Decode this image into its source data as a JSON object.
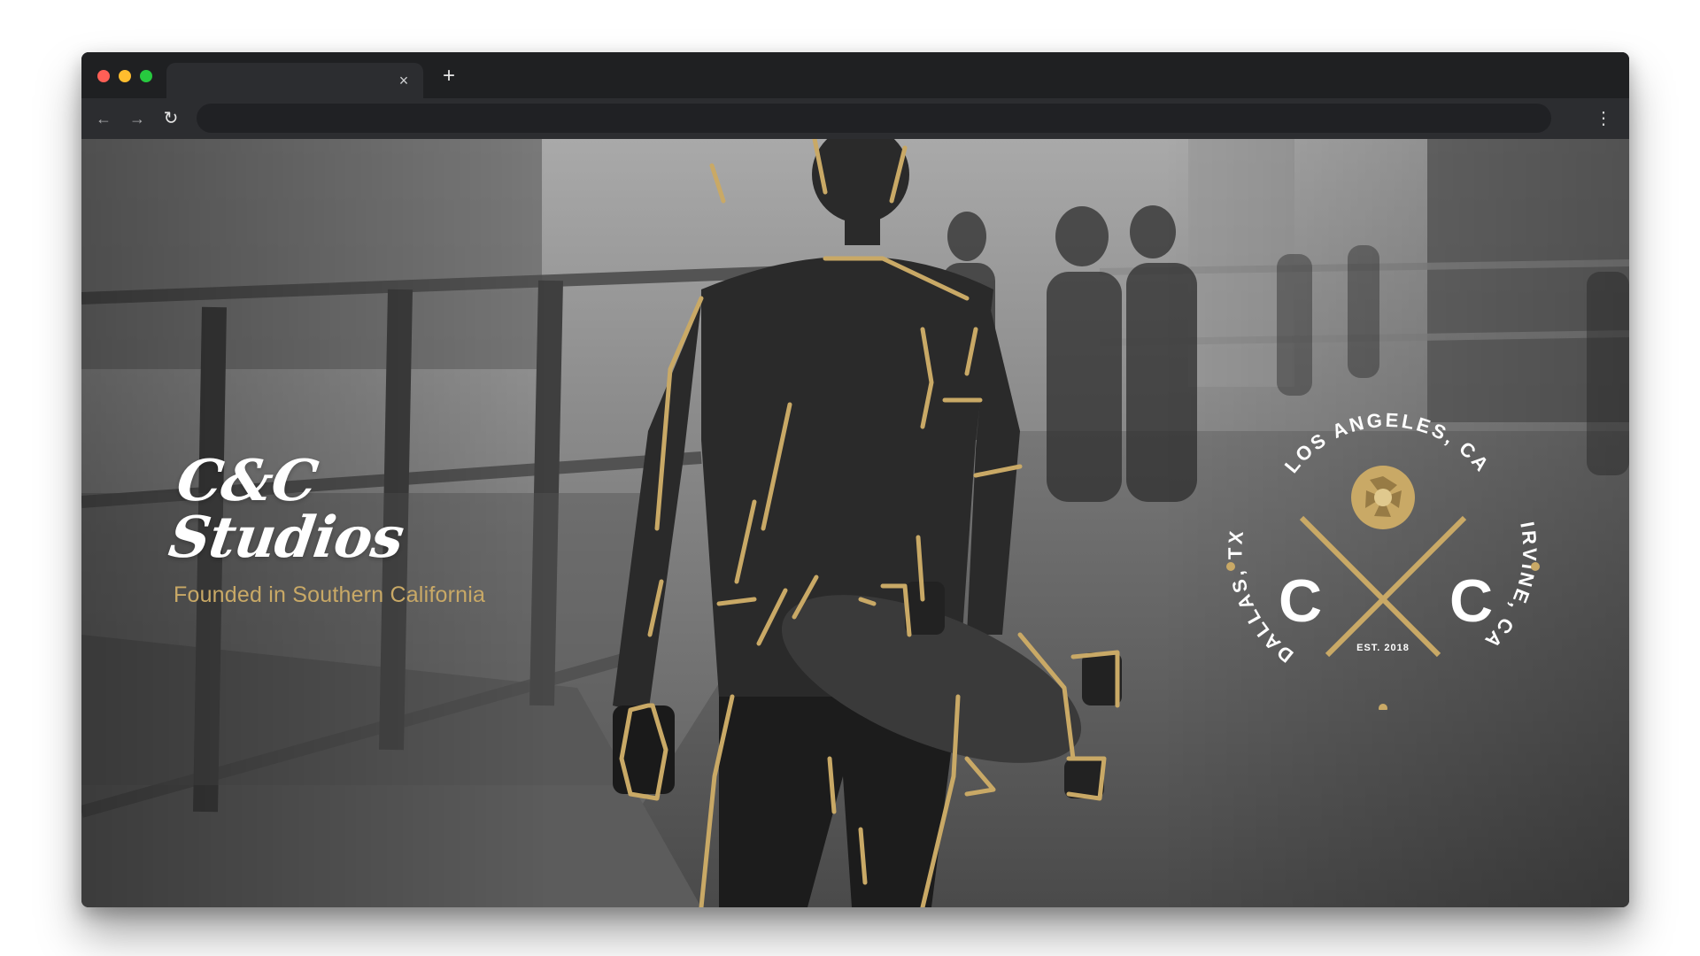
{
  "browser": {
    "traffic_lights": {
      "close": "#ff5f56",
      "minimize": "#ffbd2e",
      "maximize": "#27c93f"
    },
    "tab": {
      "title": "",
      "close_icon": "×"
    },
    "new_tab_icon": "+",
    "nav": {
      "back_icon": "←",
      "forward_icon": "→",
      "reload_icon": "↻",
      "menu_icon": "⋮"
    },
    "address": {
      "value": "",
      "placeholder": ""
    }
  },
  "hero": {
    "brand_title": "C&C Studios",
    "brand_subtitle": "Founded in Southern California",
    "accent_color": "#c9a966"
  },
  "badge": {
    "top_text": "LOS ANGELES, CA",
    "right_text": "IRVINE, CA",
    "left_text": "DALLAS, TX",
    "left_letter": "C",
    "right_letter": "C",
    "established": "EST. 2018",
    "icon": "camera-aperture-icon"
  }
}
